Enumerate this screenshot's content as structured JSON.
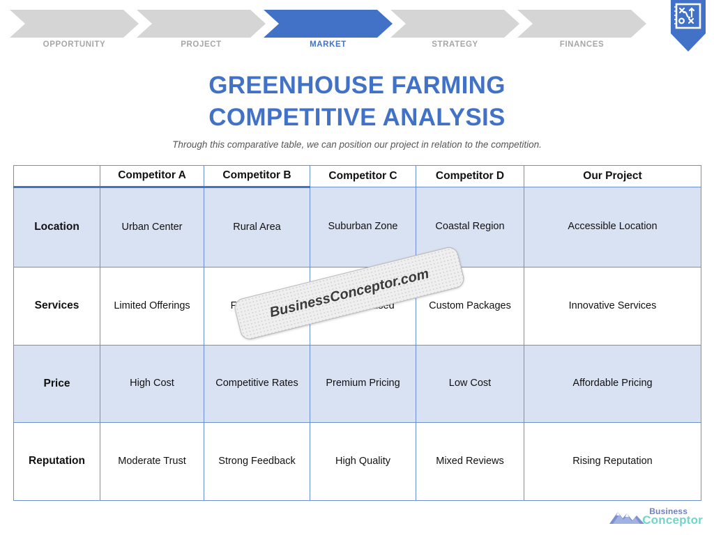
{
  "nav": {
    "steps": [
      {
        "label": "OPPORTUNITY",
        "active": false
      },
      {
        "label": "PROJECT",
        "active": false
      },
      {
        "label": "MARKET",
        "active": true
      },
      {
        "label": "STRATEGY",
        "active": false
      },
      {
        "label": "FINANCES",
        "active": false
      }
    ],
    "badge_icon": "strategy-playbook-icon",
    "active_color": "#4272c8",
    "inactive_color": "#d5d5d5",
    "inactive_label_color": "#a6a6a6"
  },
  "header": {
    "title_line1": "GREENHOUSE FARMING",
    "title_line2": "COMPETITIVE ANALYSIS",
    "subtitle": "Through this comparative table, we can position our project in relation to the competition.",
    "title_color": "#4272c8"
  },
  "table": {
    "corner_label": "",
    "columns": [
      "Competitor A",
      "Competitor B",
      "Competitor C",
      "Competitor D",
      "Our Project"
    ],
    "rows": [
      {
        "label": "Location",
        "shaded": true,
        "cells": [
          "Urban Center",
          "Rural Area",
          "Suburban Zone",
          "Coastal Region",
          "Accessible Location"
        ]
      },
      {
        "label": "Services",
        "shaded": false,
        "cells": [
          "Limited Offerings",
          "Full Service",
          "Tech Focused",
          "Custom Packages",
          "Innovative Services"
        ]
      },
      {
        "label": "Price",
        "shaded": true,
        "cells": [
          "High Cost",
          "Competitive Rates",
          "Premium Pricing",
          "Low Cost",
          "Affordable Pricing"
        ]
      },
      {
        "label": "Reputation",
        "shaded": false,
        "cells": [
          "Moderate Trust",
          "Strong Feedback",
          "High Quality",
          "Mixed Reviews",
          "Rising Reputation"
        ]
      }
    ],
    "border_color": "#6f8fd4",
    "shade_color": "#d9e2f3"
  },
  "watermark": {
    "text": "BusinessConceptor.com"
  },
  "footer": {
    "logo_word1": "Business",
    "logo_word2": "Conceptor",
    "logo_icon": "mountain-logo-icon",
    "word1_color": "#6f7fc4",
    "word2_color": "#6fd6c8"
  }
}
